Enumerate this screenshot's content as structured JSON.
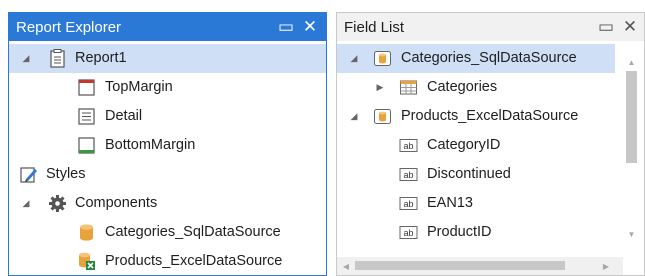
{
  "report_explorer": {
    "title": "Report Explorer",
    "maximize_icon": "▭",
    "close_icon": "✕",
    "items": [
      {
        "label": "Report1",
        "icon": "report-icon",
        "expander": "◢",
        "selected": true
      },
      {
        "label": "TopMargin",
        "icon": "top-margin-band-icon"
      },
      {
        "label": "Detail",
        "icon": "detail-band-icon"
      },
      {
        "label": "BottomMargin",
        "icon": "bottom-margin-band-icon"
      },
      {
        "label": "Styles",
        "icon": "styles-icon"
      },
      {
        "label": "Components",
        "icon": "gear-icon",
        "expander": "◢"
      },
      {
        "label": "Categories_SqlDataSource",
        "icon": "sql-datasource-icon"
      },
      {
        "label": "Products_ExcelDataSource",
        "icon": "excel-datasource-icon"
      }
    ]
  },
  "field_list": {
    "title": "Field List",
    "maximize_icon": "▭",
    "close_icon": "✕",
    "items": [
      {
        "label": "Categories_SqlDataSource",
        "icon": "datasource-icon",
        "expander": "◢",
        "selected": true
      },
      {
        "label": "Categories",
        "icon": "table-icon",
        "expander": "▶"
      },
      {
        "label": "Products_ExcelDataSource",
        "icon": "datasource-icon",
        "expander": "◢"
      },
      {
        "label": "CategoryID",
        "icon": "string-field-icon",
        "badge": "ab"
      },
      {
        "label": "Discontinued",
        "icon": "string-field-icon",
        "badge": "ab"
      },
      {
        "label": "EAN13",
        "icon": "string-field-icon",
        "badge": "ab"
      },
      {
        "label": "ProductID",
        "icon": "string-field-icon",
        "badge": "ab"
      }
    ],
    "scroll_arrows": {
      "up": "▲",
      "down": "▼",
      "left": "◀",
      "right": "▶"
    }
  },
  "colors": {
    "accent": "#2b79d7",
    "selection": "#cfe0f6",
    "datasource_orange": "#e8a33d",
    "excel_green": "#1f8a3b",
    "band_red": "#c0392b",
    "band_green": "#3a9a3a"
  }
}
